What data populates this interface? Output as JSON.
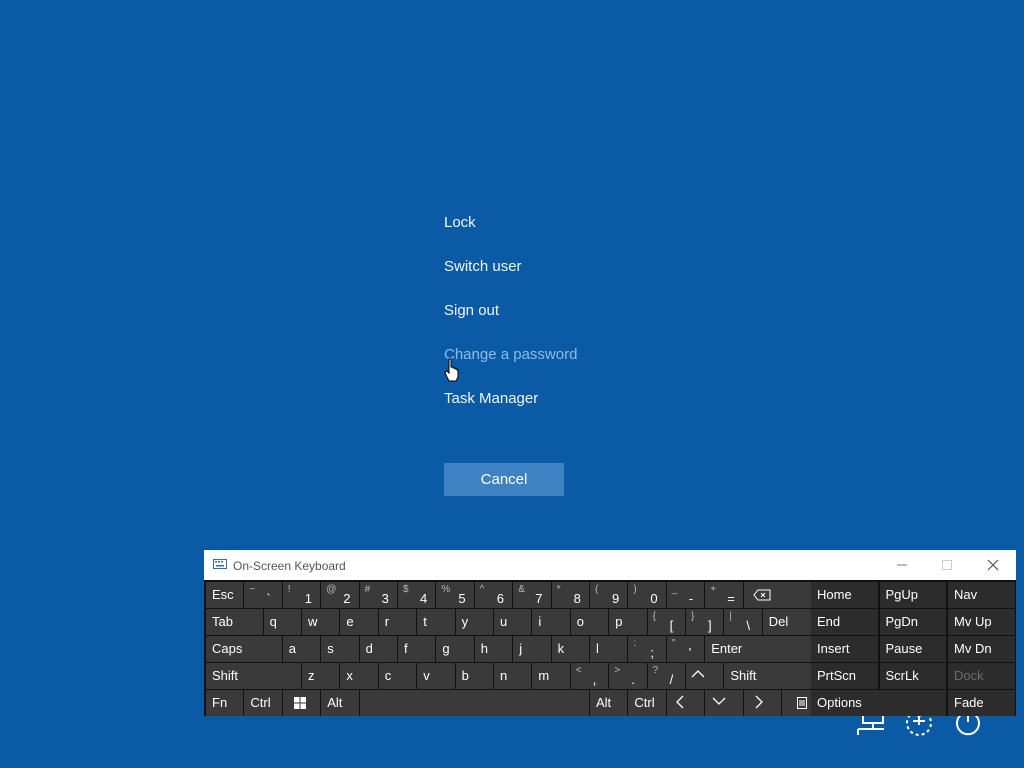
{
  "security_menu": {
    "items": [
      {
        "id": "lock",
        "label": "Lock"
      },
      {
        "id": "switch-user",
        "label": "Switch user"
      },
      {
        "id": "sign-out",
        "label": "Sign out"
      },
      {
        "id": "change-password",
        "label": "Change a password",
        "hover": true
      },
      {
        "id": "task-manager",
        "label": "Task Manager"
      }
    ],
    "cancel_label": "Cancel"
  },
  "system_icons": [
    "network-icon",
    "accessibility-icon",
    "power-icon"
  ],
  "osk": {
    "title": "On-Screen Keyboard",
    "rows": [
      [
        {
          "main": "Esc",
          "w": 1
        },
        {
          "shift": "~",
          "main": "`",
          "w": 1
        },
        {
          "shift": "!",
          "main": "1",
          "w": 1
        },
        {
          "shift": "@",
          "main": "2",
          "w": 1
        },
        {
          "shift": "#",
          "main": "3",
          "w": 1
        },
        {
          "shift": "$",
          "main": "4",
          "w": 1
        },
        {
          "shift": "%",
          "main": "5",
          "w": 1
        },
        {
          "shift": "^",
          "main": "6",
          "w": 1
        },
        {
          "shift": "&",
          "main": "7",
          "w": 1
        },
        {
          "shift": "*",
          "main": "8",
          "w": 1
        },
        {
          "shift": "(",
          "main": "9",
          "w": 1
        },
        {
          "shift": ")",
          "main": "0",
          "w": 1
        },
        {
          "shift": "_",
          "main": "-",
          "w": 1
        },
        {
          "shift": "+",
          "main": "=",
          "w": 1
        },
        {
          "icon": "backspace-icon",
          "w": 2
        }
      ],
      [
        {
          "main": "Tab",
          "w": 1.5
        },
        {
          "main": "q",
          "w": 1
        },
        {
          "main": "w",
          "w": 1
        },
        {
          "main": "e",
          "w": 1
        },
        {
          "main": "r",
          "w": 1
        },
        {
          "main": "t",
          "w": 1
        },
        {
          "main": "y",
          "w": 1
        },
        {
          "main": "u",
          "w": 1
        },
        {
          "main": "i",
          "w": 1
        },
        {
          "main": "o",
          "w": 1
        },
        {
          "main": "p",
          "w": 1
        },
        {
          "shift": "{",
          "main": "[",
          "w": 1
        },
        {
          "shift": "}",
          "main": "]",
          "w": 1
        },
        {
          "shift": "|",
          "main": "\\",
          "w": 1
        },
        {
          "main": "Del",
          "w": 1.5
        }
      ],
      [
        {
          "main": "Caps",
          "w": 2
        },
        {
          "main": "a",
          "w": 1
        },
        {
          "main": "s",
          "w": 1
        },
        {
          "main": "d",
          "w": 1
        },
        {
          "main": "f",
          "w": 1
        },
        {
          "main": "g",
          "w": 1
        },
        {
          "main": "h",
          "w": 1
        },
        {
          "main": "j",
          "w": 1
        },
        {
          "main": "k",
          "w": 1
        },
        {
          "main": "l",
          "w": 1
        },
        {
          "shift": ":",
          "main": ";",
          "w": 1
        },
        {
          "shift": "\"",
          "main": "'",
          "w": 1
        },
        {
          "main": "Enter",
          "w": 3
        }
      ],
      [
        {
          "main": "Shift",
          "w": 2.5
        },
        {
          "main": "z",
          "w": 1
        },
        {
          "main": "x",
          "w": 1
        },
        {
          "main": "c",
          "w": 1
        },
        {
          "main": "v",
          "w": 1
        },
        {
          "main": "b",
          "w": 1
        },
        {
          "main": "n",
          "w": 1
        },
        {
          "main": "m",
          "w": 1
        },
        {
          "shift": "<",
          "main": ",",
          "w": 1
        },
        {
          "shift": ">",
          "main": ".",
          "w": 1
        },
        {
          "shift": "?",
          "main": "/",
          "w": 1
        },
        {
          "icon": "arrow-up-icon",
          "w": 1
        },
        {
          "main": "Shift",
          "w": 2.5
        }
      ],
      [
        {
          "main": "Fn",
          "w": 1
        },
        {
          "main": "Ctrl",
          "w": 1
        },
        {
          "icon": "windows-icon",
          "w": 1
        },
        {
          "main": "Alt",
          "w": 1
        },
        {
          "main": "",
          "w": 6,
          "name": "space-key"
        },
        {
          "main": "Alt",
          "w": 1
        },
        {
          "main": "Ctrl",
          "w": 1
        },
        {
          "icon": "arrow-left-icon",
          "w": 1
        },
        {
          "icon": "arrow-down-icon",
          "w": 1
        },
        {
          "icon": "arrow-right-icon",
          "w": 1
        },
        {
          "icon": "menu-key-icon",
          "w": 1
        }
      ]
    ],
    "nav_rows": [
      [
        {
          "main": "Home",
          "w": 1
        },
        {
          "main": "PgUp",
          "w": 1
        },
        {
          "main": "Nav",
          "w": 1
        }
      ],
      [
        {
          "main": "End",
          "w": 1
        },
        {
          "main": "PgDn",
          "w": 1
        },
        {
          "main": "Mv Up",
          "w": 1
        }
      ],
      [
        {
          "main": "Insert",
          "w": 1
        },
        {
          "main": "Pause",
          "w": 1
        },
        {
          "main": "Mv Dn",
          "w": 1
        }
      ],
      [
        {
          "main": "PrtScn",
          "w": 1
        },
        {
          "main": "ScrLk",
          "w": 1
        },
        {
          "main": "Dock",
          "w": 1,
          "dim": true
        }
      ],
      [
        {
          "main": "Options",
          "w": 2
        },
        {
          "main": "Fade",
          "w": 1
        }
      ]
    ]
  }
}
